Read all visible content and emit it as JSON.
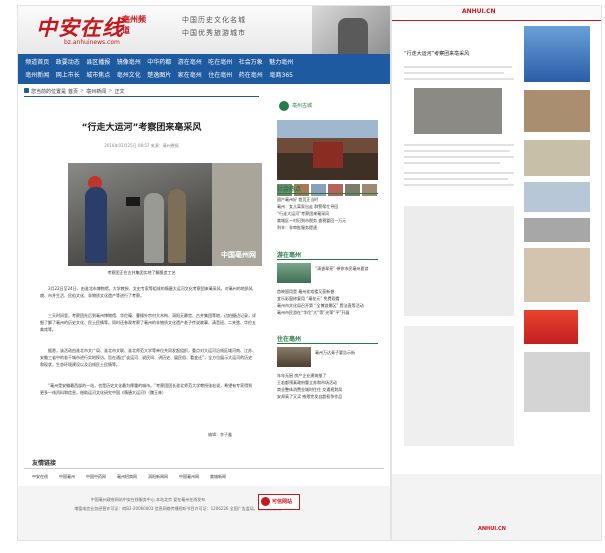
{
  "header": {
    "logo": "中安在线",
    "city": "亳州频道",
    "url": "bz.anhuinews.com",
    "slogan1": "中国历史文化名城",
    "slogan2": "中国优秀旅游城市"
  },
  "nav": {
    "row1": [
      "频道首页",
      "政要动态",
      "县区播报",
      "镜像亳州",
      "中华药都",
      "游在亳州",
      "吃在亳州",
      "社会万象",
      "魅力亳州"
    ],
    "row2": [
      "亳州新闻",
      "网上市长",
      "城市焦点",
      "亳州文化",
      "楚逸图片",
      "家在亳州",
      "住在亳州",
      "药在亳州",
      "亳商365"
    ]
  },
  "breadcrumb": [
    "您当前的位置是",
    "首页",
    "亳州新闻",
    "正文"
  ],
  "article": {
    "title": "“行走大运河”考察团来亳采风",
    "meta": "2016年03月25日 08:57  来源：亳州晚报",
    "watermark": "中国亳州网",
    "caption": "考察团正在古井集团实地了解酿造工艺",
    "p1": "3月22日至24日，由淮北市博物馆、大学教授、文史专家等组成的隋唐大运河文化考察团来亳采风，对亳州的地质风貌、市井生活、民俗文化、非物质文化遗产等进行了考察。",
    "p2": "三天时间里，考察团先后到亳州博物馆、华佗庵、曹操外宗村大木构、涡阳天静宫、古井集团等地，边拍摄边记录，详细了解了亳州的历史文化、民土民情等。同时还参观考察了亳州的非物质文化遗产老子传说故事、清音班、二夹弦、华佗五禽戏等。",
    "p3": "据悉，该活动由淮北市文广局、淮北市文联、淮北师范大学等单位共同发起组织，重点对大运河沿线区域河南、江苏、安徽三省中的若干城市进行实地探访。旨在通过“谈运河、说民间、讲历史、展民俗、看变迁”，全方位展示大运河的历史和现状，生态环境建设以及沿线民土民情等。",
    "p4": "“亳州是安徽最西部的一站，也是历史文化最为厚重的城市。”考察团团长淮北师范大学教授张宏说，希望有专家得到更多一线资料和信息，借助运河文化研究中国《隋唐大运河》（魏玉林）",
    "editor": "编辑：李子鑫"
  },
  "sidebar": {
    "logo_text": "亳州古城",
    "section1_title": "社会热点",
    "section1_items": [
      "国产亳州好 首页正当时",
      "亳州：女儿离家出走 群警帮忙寻回",
      "“行走大运河”考察团来亳采风",
      "谯城区一村妇到市税务 查税要回一万元",
      "利辛：非审批服务提速"
    ],
    "section2_title": "游在亳州",
    "section2_feature": "“清香翠亮” 带你市民亳州夏游",
    "section2_items": [
      "首映国用是 亳州花戏楼又获新誉",
      "宜乐彩窗修复用 “亳花元” 免费观看",
      "亳州市文化局召开第 “全博游景区” 暨法直等活动",
      "亳州市民游在“华佗”大“等”光荣“平”开展"
    ],
    "section3_title": "住在亳州",
    "section3_feature": "亳州万达青子要告示街",
    "section3_items": [
      "年年无厨 房产企业建筑推了",
      "王若都预真政府重立苏和市场活动",
      "商业整体消费业城时住住 交通规划局",
      "安邦高了又买 感恩完发自超权争作品"
    ]
  },
  "links": {
    "title": "友情链接",
    "items": [
      "中安在线",
      "中国亳州",
      "中国中药网",
      "亳州招商网",
      "涡阳新闻网",
      "中国亳州网",
      "谯城新闻"
    ]
  },
  "footer": {
    "line1": "中国亳州政府网站中安在线服务中心 本站北京 爱在亳州在线发布",
    "line2": "增值电信业务经营许可证：皖B2-20060003 信息网络传播视听节目许可证：1206226 全国广告监局，亳州在线协办",
    "badge": "可信网站"
  },
  "mini": {
    "logo": "ANHUI.CN",
    "title": "“行走大运河”考察团来亳采风",
    "footer_logo": "ANHUI.CN"
  }
}
